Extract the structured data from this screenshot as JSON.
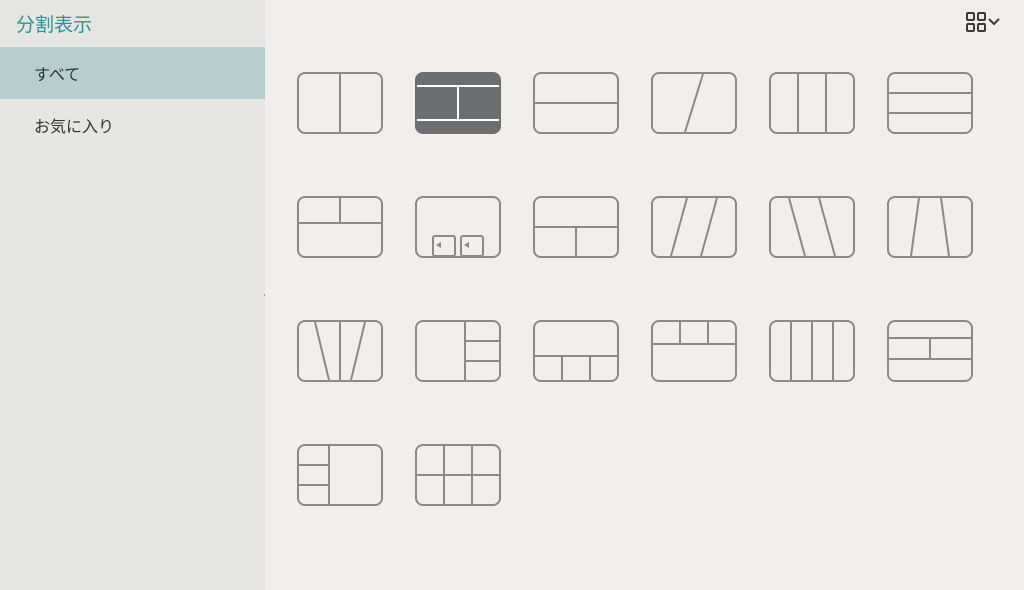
{
  "sidebar": {
    "title": "分割表示",
    "items": [
      {
        "label": "すべて",
        "selected": true
      },
      {
        "label": "お気に入り",
        "selected": false
      }
    ]
  },
  "selected_thumb_index": 1,
  "thumbs": [
    "split-vertical-2",
    "split-vertical-2-letterbox",
    "split-horizontal-2",
    "split-diagonal-2",
    "columns-3",
    "rows-3",
    "top-right-bottom-3",
    "pip-bottom-2",
    "t-layout-3",
    "double-diagonal-3a",
    "double-diagonal-3b",
    "center-diagonal-3",
    "w-columns-3",
    "right-stack-3",
    "bottom-row-4",
    "top-row-4",
    "columns-4",
    "header-rows-4",
    "left-stack-3",
    "grid-2x3-6"
  ]
}
